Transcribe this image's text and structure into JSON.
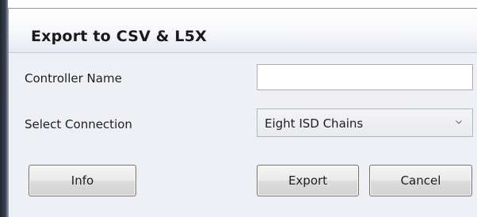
{
  "dialog": {
    "title": "Export to CSV & L5X",
    "fields": {
      "controller_name_label": "Controller Name",
      "controller_name_value": "",
      "select_connection_label": "Select Connection",
      "select_connection_value": "Eight ISD Chains"
    },
    "buttons": {
      "info": "Info",
      "export": "Export",
      "cancel": "Cancel"
    },
    "icons": {
      "dropdown": "chevron-down-icon"
    }
  }
}
